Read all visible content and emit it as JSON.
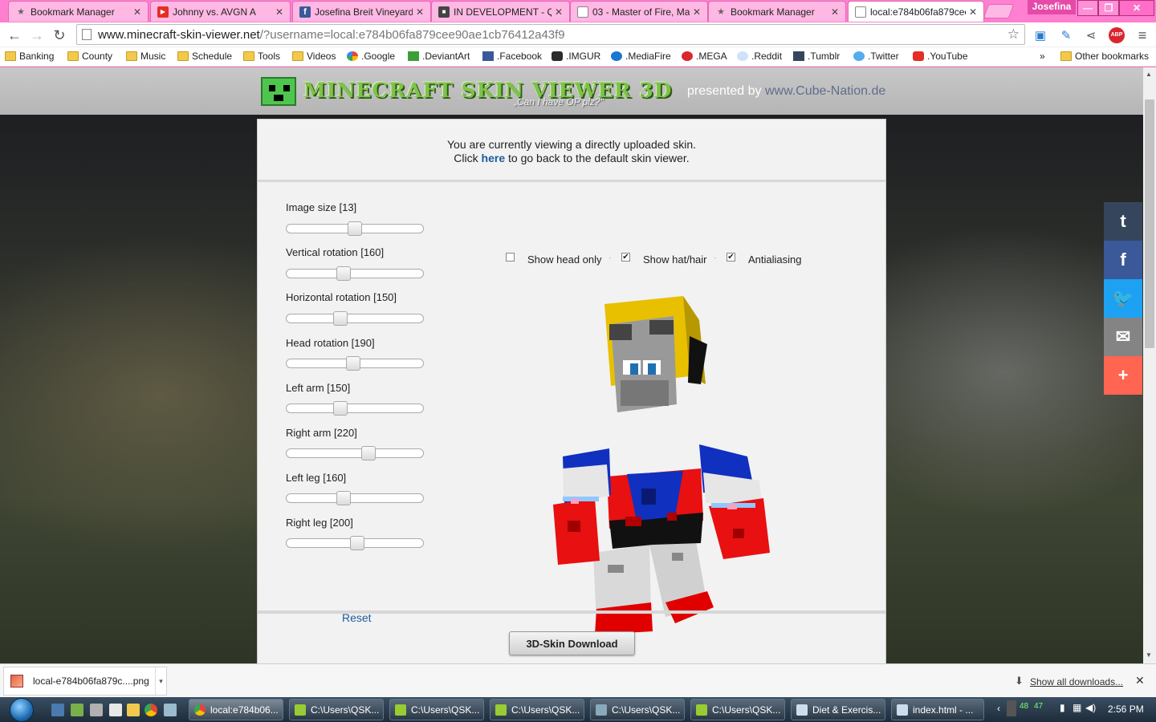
{
  "browser": {
    "tabs": [
      {
        "label": "Bookmark Manager",
        "icon": "star-icon"
      },
      {
        "label": "Johnny vs. AVGN A",
        "icon": "youtube-icon"
      },
      {
        "label": "Josefina Breit Vineyard",
        "icon": "facebook-icon"
      },
      {
        "label": "IN DEVELOPMENT - Q",
        "icon": "skin-icon"
      },
      {
        "label": "03 - Master of Fire, Ma",
        "icon": "page-icon"
      },
      {
        "label": "Bookmark Manager",
        "icon": "star-icon"
      },
      {
        "label": "local:e784b06fa879cee",
        "icon": "page-icon"
      }
    ],
    "profile_name": "Josefina",
    "url_host": "www.minecraft-skin-viewer.net",
    "url_rest": "/?username=local:e784b06fa879cee90ae1cb76412a43f9",
    "bookmarks": [
      {
        "label": "Banking",
        "icon": "folder-icon"
      },
      {
        "label": "County",
        "icon": "folder-icon"
      },
      {
        "label": "Music",
        "icon": "folder-icon"
      },
      {
        "label": "Schedule",
        "icon": "folder-icon"
      },
      {
        "label": "Tools",
        "icon": "folder-icon"
      },
      {
        "label": "Videos",
        "icon": "folder-icon"
      },
      {
        "label": ".Google",
        "icon": "google-icon"
      },
      {
        "label": ".DeviantArt",
        "icon": "deviantart-icon"
      },
      {
        "label": ".Facebook",
        "icon": "facebook-icon"
      },
      {
        "label": ".IMGUR",
        "icon": "imgur-icon"
      },
      {
        "label": ".MediaFire",
        "icon": "mediafire-icon"
      },
      {
        "label": ".MEGA",
        "icon": "mega-icon"
      },
      {
        "label": ".Reddit",
        "icon": "reddit-icon"
      },
      {
        "label": ".Tumblr",
        "icon": "tumblr-icon"
      },
      {
        "label": ".Twitter",
        "icon": "twitter-icon"
      },
      {
        "label": ".YouTube",
        "icon": "youtube-icon"
      }
    ],
    "bookmarks_overflow": "»",
    "other_bookmarks": "Other bookmarks"
  },
  "site": {
    "logo_title": "MINECRAFT SKIN VIEWER 3D",
    "logo_subtitle": "„Can I have OP plz?\"",
    "presented_prefix": "presented by ",
    "presented_link": "www.Cube-Nation.de",
    "info_line1": "You are currently viewing a directly uploaded skin.",
    "info_line2_pre": "Click ",
    "info_link": "here",
    "info_line2_post": " to go back to the default skin viewer.",
    "sliders": [
      {
        "label": "Image size [13]",
        "value": 0.5
      },
      {
        "label": "Vertical rotation [160]",
        "value": 0.41
      },
      {
        "label": "Horizontal rotation [150]",
        "value": 0.38
      },
      {
        "label": "Head rotation [190]",
        "value": 0.49
      },
      {
        "label": "Left arm [150]",
        "value": 0.38
      },
      {
        "label": "Right arm [220]",
        "value": 0.61
      },
      {
        "label": "Left leg [160]",
        "value": 0.41
      },
      {
        "label": "Right leg [200]",
        "value": 0.52
      }
    ],
    "reset_label": "Reset",
    "options": [
      {
        "label": "Show head only",
        "checked": false
      },
      {
        "label": "Show hat/hair",
        "checked": true
      },
      {
        "label": "Antialiasing",
        "checked": true
      }
    ],
    "download_label": "3D-Skin Download",
    "share": [
      {
        "icon": "tumblr-icon",
        "glyph": "t",
        "color": "#35465c"
      },
      {
        "icon": "facebook-icon",
        "glyph": "f",
        "color": "#3b5998"
      },
      {
        "icon": "twitter-icon",
        "glyph": "🐦",
        "color": "#1da1f2"
      },
      {
        "icon": "email-icon",
        "glyph": "✉",
        "color": "#848484"
      },
      {
        "icon": "more-icon",
        "glyph": "+",
        "color": "#ff6550"
      }
    ]
  },
  "downloads": {
    "file": "local-e784b06fa879c....png",
    "show_all": "Show all downloads..."
  },
  "taskbar": {
    "tasks": [
      {
        "label": "local:e784b06...",
        "icon": "chrome-icon"
      },
      {
        "label": "C:\\Users\\QSK...",
        "icon": "notepadpp-icon"
      },
      {
        "label": "C:\\Users\\QSK...",
        "icon": "notepadpp-icon"
      },
      {
        "label": "C:\\Users\\QSK...",
        "icon": "notepadpp-icon"
      },
      {
        "label": "C:\\Users\\QSK...",
        "icon": "notepadpp-icon"
      },
      {
        "label": "C:\\Users\\QSK...",
        "icon": "notepadpp-icon"
      },
      {
        "label": "Diet & Exercis...",
        "icon": "document-icon"
      },
      {
        "label": "index.html - ...",
        "icon": "document-icon"
      }
    ],
    "tray_nums": [
      "48",
      "47"
    ],
    "clock": "2:56 PM"
  }
}
